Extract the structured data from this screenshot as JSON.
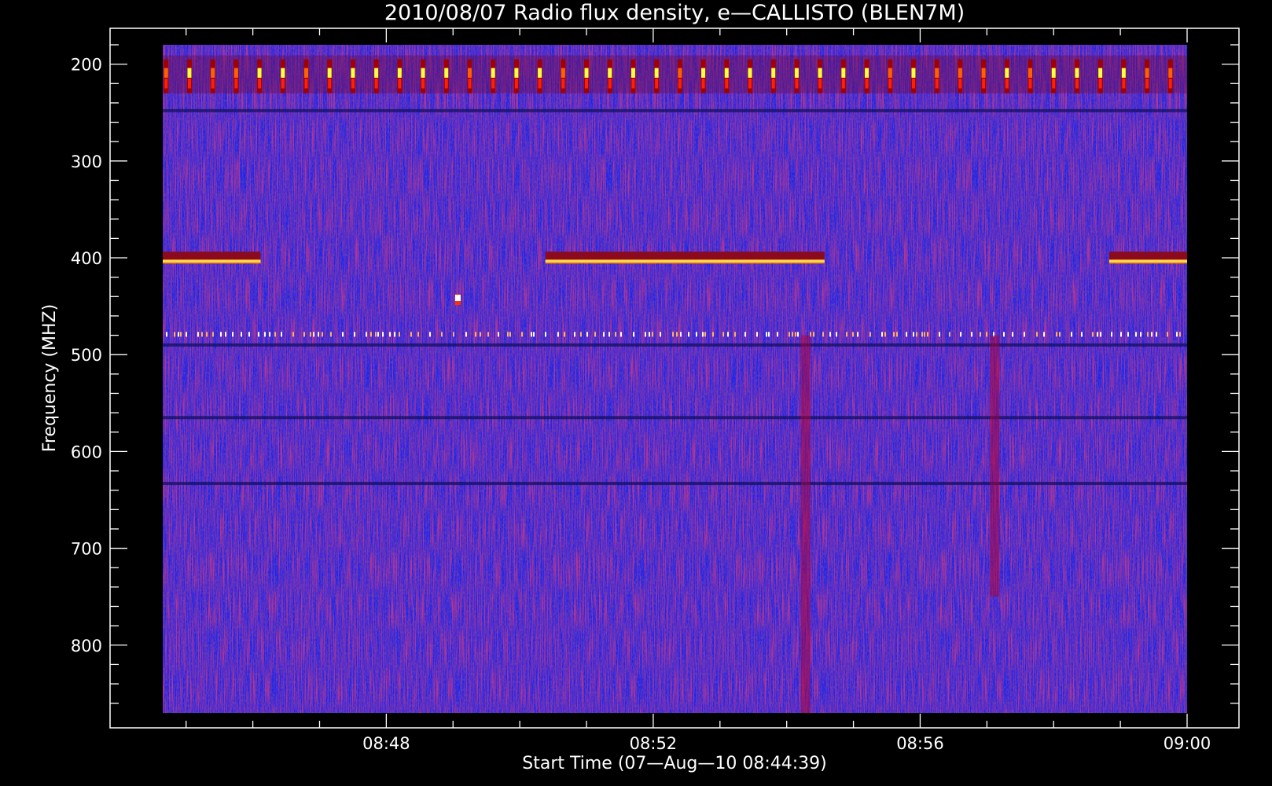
{
  "chart_data": {
    "type": "heatmap",
    "title": "2010/08/07  Radio flux density, e—CALLISTO (BLEN7M)",
    "xlabel": "Start Time (07—Aug—10 08:44:39)",
    "ylabel": "Frequency (MHZ)",
    "x_range": [
      "08:44:39",
      "09:00:00"
    ],
    "y_range_mhz": [
      180,
      870
    ],
    "y_inverted": true,
    "x_ticks": [
      "08:48",
      "08:52",
      "08:56",
      "09:00"
    ],
    "y_ticks": [
      200,
      300,
      400,
      500,
      600,
      700,
      800
    ],
    "colormap": [
      "#0000ff",
      "#800000",
      "#ff0000",
      "#ffff00",
      "#ffffff"
    ],
    "background_color": "#2222ee",
    "features": [
      {
        "kind": "periodic-spikes",
        "freq_mhz": [
          195,
          230
        ],
        "note": "narrow bursts about every 20 s"
      },
      {
        "kind": "dark-band",
        "freq_mhz": 248
      },
      {
        "kind": "bright-band",
        "freq_mhz": 405,
        "time": [
          "08:44:39",
          "08:46:07"
        ]
      },
      {
        "kind": "bright-band",
        "freq_mhz": 405,
        "time": [
          "08:50:23",
          "08:54:34"
        ]
      },
      {
        "kind": "bright-band",
        "freq_mhz": 405,
        "time": [
          "08:58:50",
          "09:00:00"
        ]
      },
      {
        "kind": "spot",
        "freq_mhz": 443,
        "time": "08:49:04"
      },
      {
        "kind": "dotted-band",
        "freq_mhz": 479
      },
      {
        "kind": "dark-band",
        "freq_mhz": 490
      },
      {
        "kind": "dark-band",
        "freq_mhz": 565
      },
      {
        "kind": "dark-band",
        "freq_mhz": 633
      },
      {
        "kind": "vertical-streak",
        "time": "08:54:17",
        "freq_mhz": [
          480,
          870
        ]
      },
      {
        "kind": "vertical-streak",
        "time": "08:57:07",
        "freq_mhz": [
          480,
          750
        ]
      }
    ]
  }
}
